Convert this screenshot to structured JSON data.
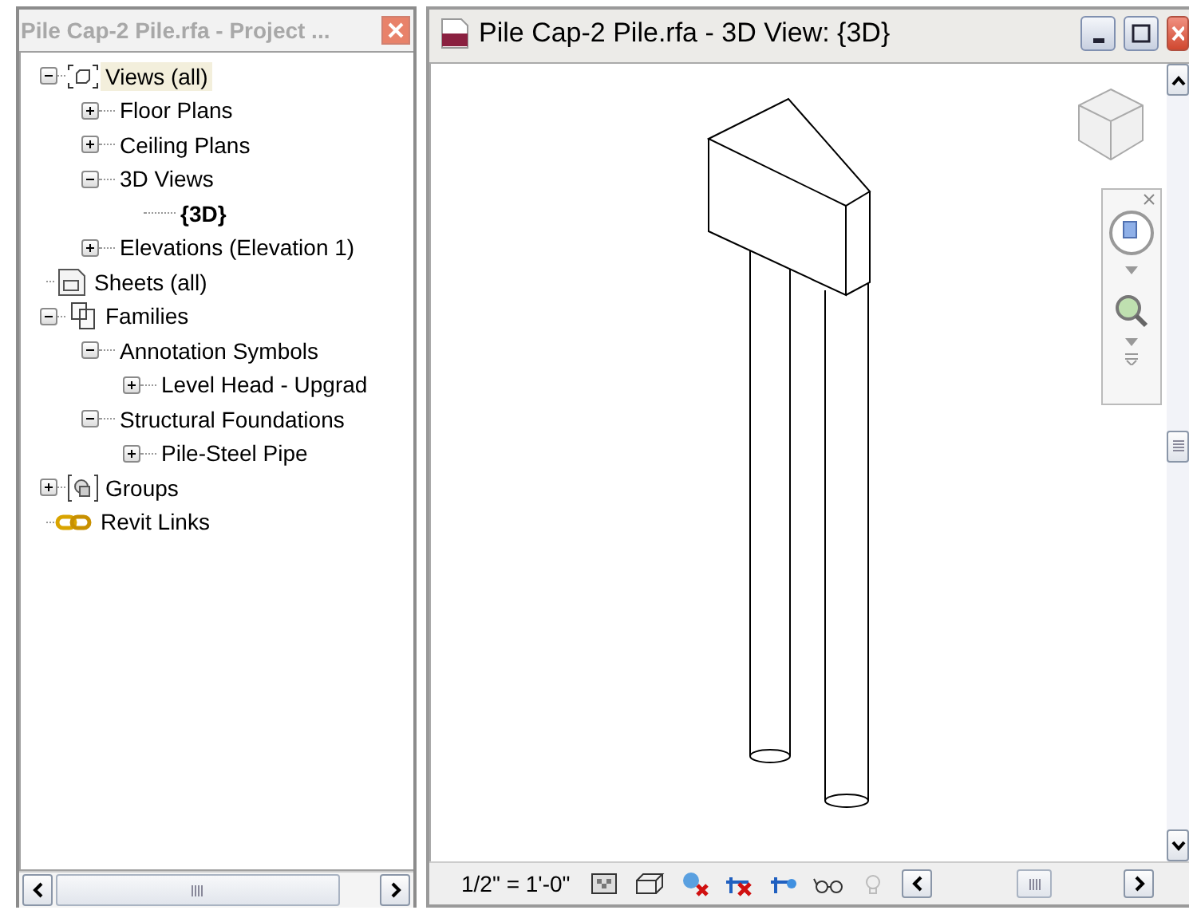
{
  "browser_panel": {
    "title": "Pile Cap-2 Pile.rfa - Project ...",
    "tree": [
      {
        "label": "Views (all)",
        "kind": "views",
        "expanded": true,
        "selected": true,
        "children": [
          {
            "label": "Floor Plans",
            "expanded": false
          },
          {
            "label": "Ceiling Plans",
            "expanded": false
          },
          {
            "label": "3D Views",
            "expanded": true,
            "children": [
              {
                "label": "{3D}",
                "active": true
              }
            ]
          },
          {
            "label": "Elevations (Elevation 1)",
            "expanded": false
          }
        ]
      },
      {
        "label": "Sheets (all)",
        "kind": "sheets",
        "selected": false
      },
      {
        "label": "Families",
        "kind": "families",
        "expanded": true,
        "selected": false,
        "children": [
          {
            "label": "Annotation Symbols",
            "expanded": true,
            "children": [
              {
                "label": "Level Head - Upgrad",
                "expanded": false
              }
            ]
          },
          {
            "label": "Structural Foundations",
            "expanded": true,
            "children": [
              {
                "label": "Pile-Steel Pipe",
                "expanded": false
              }
            ]
          }
        ]
      },
      {
        "label": "Groups",
        "kind": "groups",
        "expanded": false,
        "selected": false
      },
      {
        "label": "Revit Links",
        "kind": "links",
        "selected": false
      }
    ]
  },
  "view_window": {
    "title": "Pile Cap-2 Pile.rfa - 3D View: {3D}",
    "scale": "1/2\" = 1'-0\""
  }
}
